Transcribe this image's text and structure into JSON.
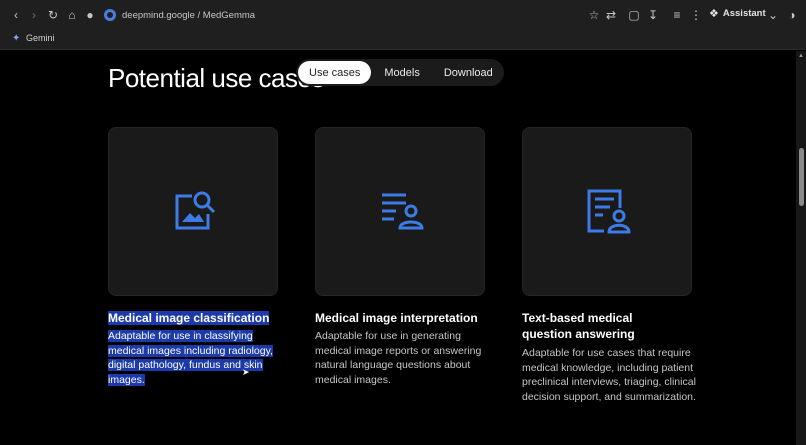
{
  "browser": {
    "address": "deepmind.google / MedGemma",
    "assistant_label": "Assistant",
    "bookmark_label": "Gemini"
  },
  "page": {
    "section_title": "Potential use cases",
    "tabs": [
      {
        "label": "Use cases",
        "active": true
      },
      {
        "label": "Models",
        "active": false
      },
      {
        "label": "Download",
        "active": false
      }
    ],
    "cards": [
      {
        "icon": "image-search-icon",
        "title": "Medical image classification",
        "description": "Adaptable for use in classifying medical images including radiology, digital pathology, fundus and skin images."
      },
      {
        "icon": "list-person-icon",
        "title": "Medical image interpretation",
        "description": "Adaptable for use in generating medical image reports or answering natural language questions about medical images."
      },
      {
        "icon": "document-person-icon",
        "title": "Text-based medical question answering",
        "description": "Adaptable for use cases that require medical knowledge, including patient preclinical interviews, triaging, clinical decision support, and summarization."
      }
    ]
  },
  "colors": {
    "accent_blue": "#3d7be6",
    "highlight": "#1c3aa9",
    "background": "#000000",
    "card_bg": "#1a1a1a"
  }
}
